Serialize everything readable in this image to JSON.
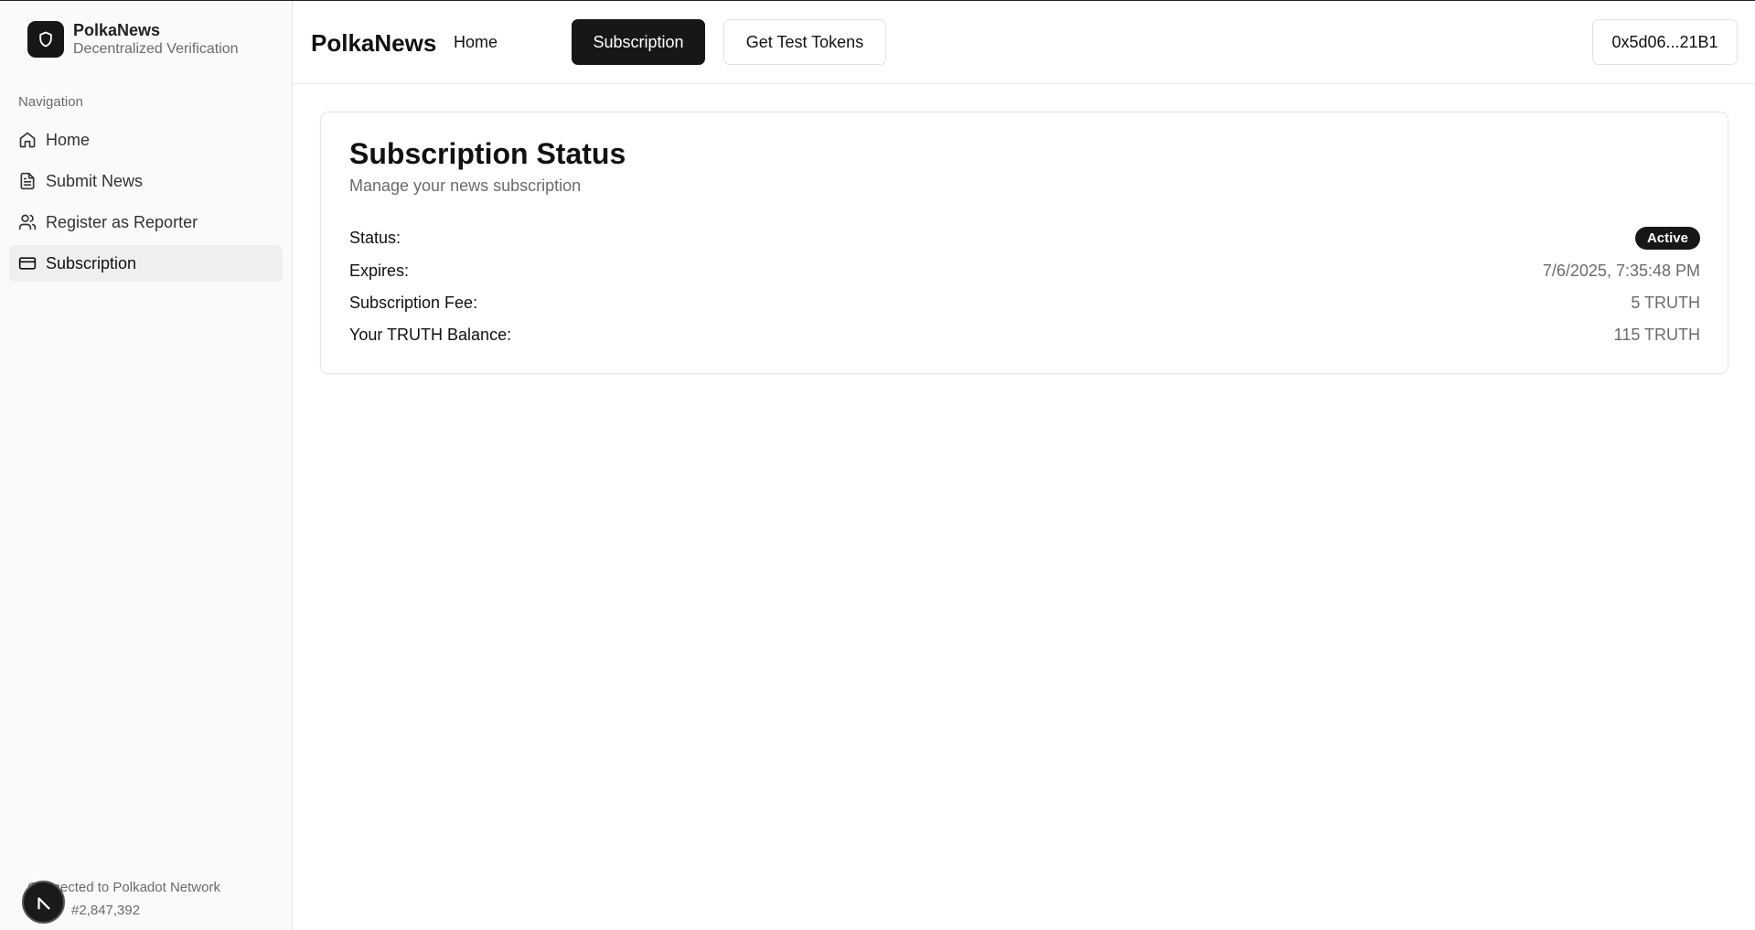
{
  "brand": {
    "name": "PolkaNews",
    "subtitle": "Decentralized Verification"
  },
  "sidebar": {
    "heading": "Navigation",
    "items": [
      {
        "label": "Home",
        "icon": "home-icon"
      },
      {
        "label": "Submit News",
        "icon": "file-text-icon"
      },
      {
        "label": "Register as Reporter",
        "icon": "users-icon"
      },
      {
        "label": "Subscription",
        "icon": "credit-card-icon",
        "active": true
      }
    ],
    "footer": {
      "network": "Connected to Polkadot Network",
      "block": "#2,847,392"
    }
  },
  "header": {
    "title": "PolkaNews",
    "nav": {
      "home": "Home",
      "subscription": "Subscription",
      "tokens": "Get Test Tokens"
    },
    "wallet": "0x5d06...21B1"
  },
  "main": {
    "card": {
      "title": "Subscription Status",
      "description": "Manage your news subscription",
      "rows": [
        {
          "label": "Status:",
          "value": "Active"
        },
        {
          "label": "Expires:",
          "value": "7/6/2025, 7:35:48 PM"
        },
        {
          "label": "Subscription Fee:",
          "value": "5 TRUTH"
        },
        {
          "label": "Your TRUTH Balance:",
          "value": "115 TRUTH"
        }
      ]
    }
  },
  "colors": {
    "primary": "#171717",
    "muted": "#6b6b6b",
    "border": "#e5e5e5",
    "sidebar_bg": "#fafafa"
  }
}
